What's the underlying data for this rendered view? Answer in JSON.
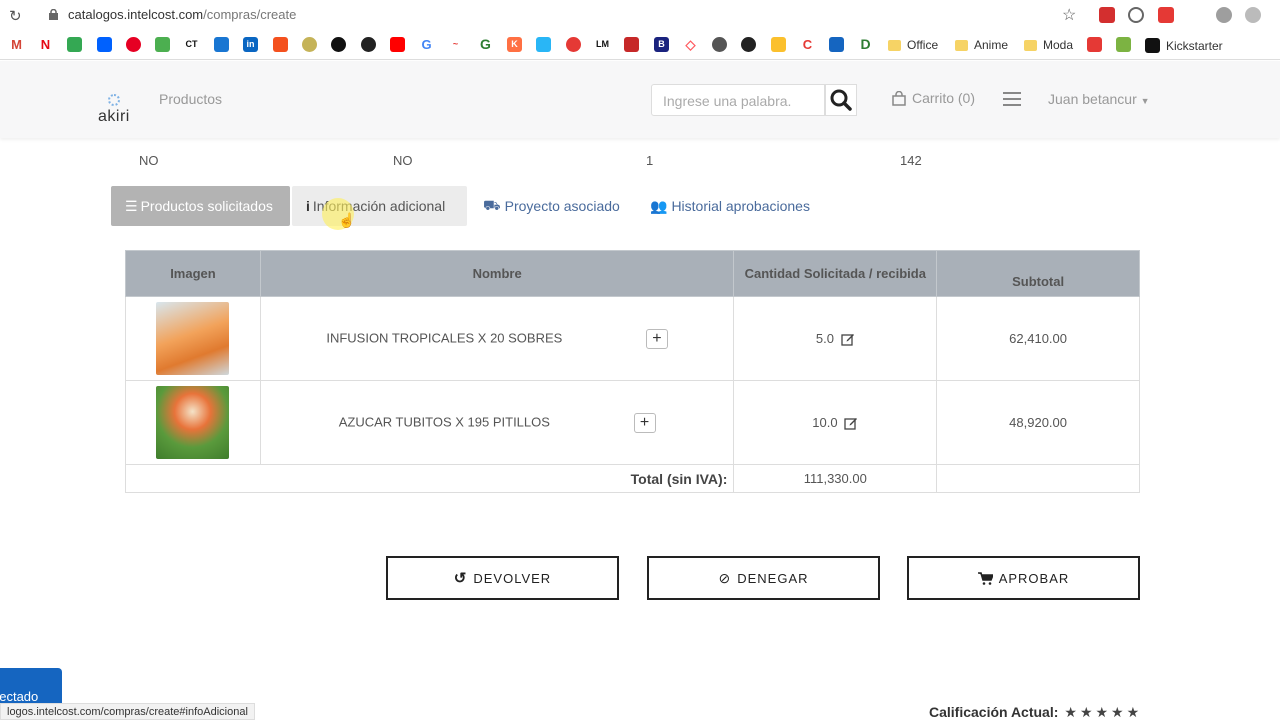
{
  "browser": {
    "url_host": "catalogos.intelcost.com",
    "url_path": "/compras/create",
    "bookmarks": {
      "folders": [
        "Office",
        "Anime",
        "Moda"
      ],
      "kickstarter": "Kickstarter"
    },
    "status_url": "logos.intelcost.com/compras/create#infoAdicional"
  },
  "header": {
    "logo": "akiri",
    "nav_productos": "Productos",
    "search_placeholder": "Ingrese una palabra.",
    "cart": "Carrito (0)",
    "user": "Juan betancur"
  },
  "info_row": [
    "NO",
    "NO",
    "1",
    "142"
  ],
  "tabs": [
    {
      "label": "Productos solicitados",
      "icon": "list-icon"
    },
    {
      "label": "Información adicional",
      "icon": "info-icon"
    },
    {
      "label": "Proyecto asociado",
      "icon": "car-icon"
    },
    {
      "label": "Historial aprobaciones",
      "icon": "users-icon"
    }
  ],
  "table": {
    "headers": [
      "Imagen",
      "Nombre",
      "Cantidad Solicitada / recibida",
      "Subtotal"
    ],
    "rows": [
      {
        "name": "INFUSION TROPICALES X 20 SOBRES",
        "qty": "5.0",
        "subtotal": "62,410.00"
      },
      {
        "name": "AZUCAR TUBITOS X 195 PITILLOS",
        "qty": "10.0",
        "subtotal": "48,920.00"
      }
    ],
    "total_label": "Total (sin IVA):",
    "total_value": "111,330.00"
  },
  "actions": {
    "devolver": "DEVOLVER",
    "denegar": "DENEGAR",
    "aprobar": "APROBAR"
  },
  "footer": {
    "connected": "nectado",
    "rating_label": "Calificación Actual:",
    "stars": "★★★★★"
  }
}
